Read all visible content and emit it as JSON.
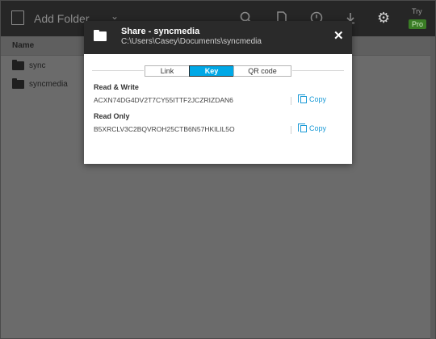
{
  "topbar": {
    "add_folder_label": "Add Folder",
    "try_label": "Try",
    "pro_label": "Pro"
  },
  "list": {
    "header": "Name",
    "items": [
      {
        "name": "sync"
      },
      {
        "name": "syncmedia"
      }
    ]
  },
  "dialog": {
    "title": "Share - syncmedia",
    "path": "C:\\Users\\Casey\\Documents\\syncmedia",
    "tabs": [
      {
        "label": "Link",
        "active": false
      },
      {
        "label": "Key",
        "active": true
      },
      {
        "label": "QR code",
        "active": false
      }
    ],
    "read_write": {
      "label": "Read & Write",
      "key": "ACXN74DG4DV2T7CY55ITTF2JCZRIZDAN6",
      "copy_label": "Copy"
    },
    "read_only": {
      "label": "Read Only",
      "key": "B5XRCLV3C2BQVROH25CTB6N57HKILIL5O",
      "copy_label": "Copy"
    }
  },
  "colors": {
    "accent": "#00a8e6",
    "topbar": "#262626",
    "pro_badge": "#3a7d25"
  }
}
